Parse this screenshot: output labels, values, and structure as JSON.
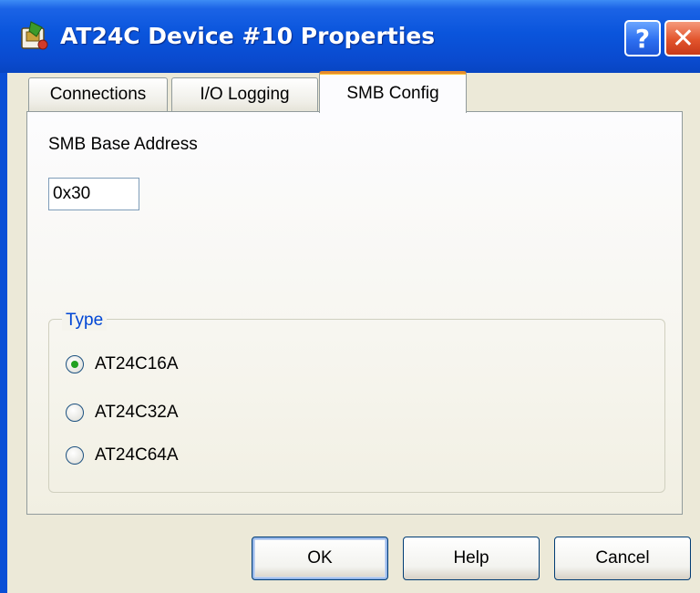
{
  "window": {
    "title": "AT24C Device #10 Properties"
  },
  "titlebar_buttons": {
    "help_glyph": "?",
    "close_glyph": "✕"
  },
  "tabs": [
    {
      "label": "Connections",
      "active": false
    },
    {
      "label": "I/O Logging",
      "active": false
    },
    {
      "label": "SMB Config",
      "active": true
    }
  ],
  "smb": {
    "base_address_label": "SMB Base Address",
    "base_address_value": "0x30"
  },
  "type_group": {
    "legend": "Type",
    "options": [
      {
        "label": "AT24C16A",
        "selected": true
      },
      {
        "label": "AT24C32A",
        "selected": false
      },
      {
        "label": "AT24C64A",
        "selected": false
      }
    ]
  },
  "buttons": {
    "ok": "OK",
    "help": "Help",
    "cancel": "Cancel"
  },
  "colors": {
    "title_bar": "#0a55dc",
    "dialog_face": "#ece9d8",
    "active_tab_accent": "#e68b2c",
    "group_legend": "#0046d5",
    "radio_selected": "#21a121"
  },
  "icons": {
    "app": "device-properties-icon"
  }
}
